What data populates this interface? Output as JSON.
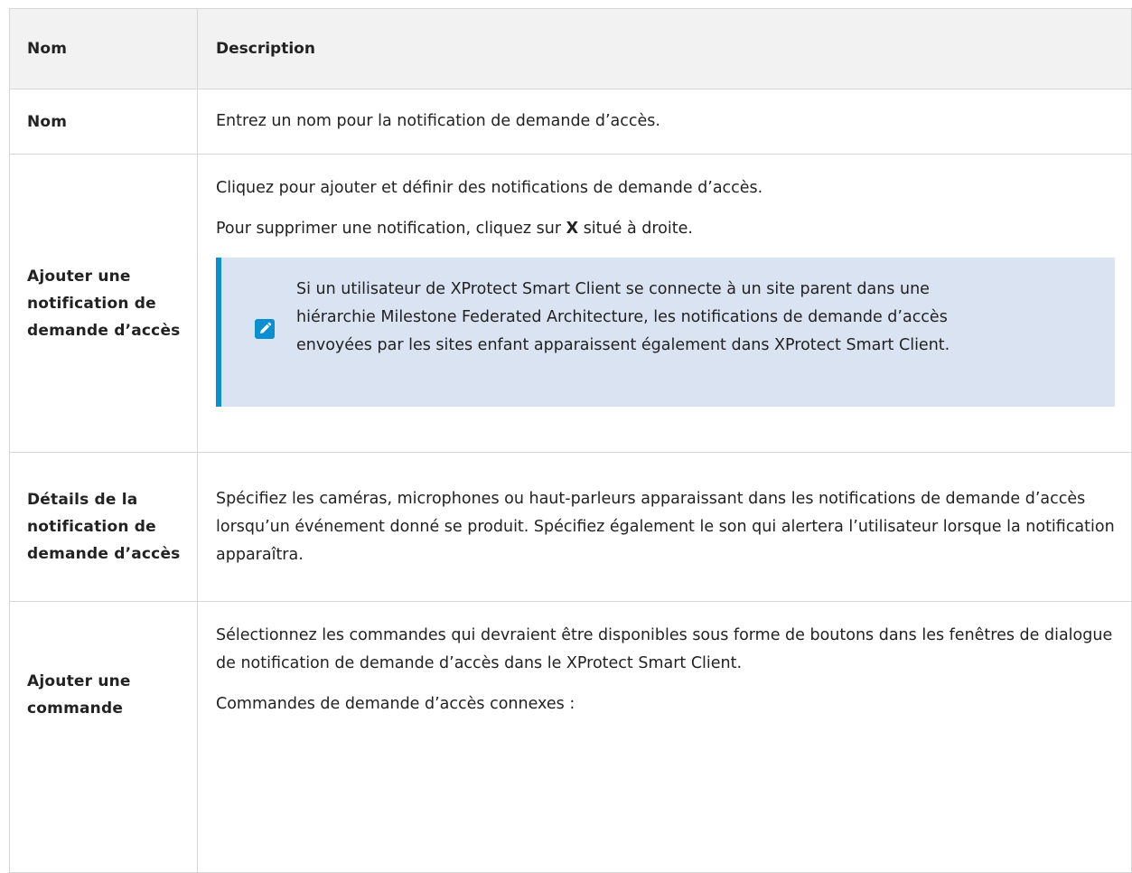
{
  "header": {
    "name_col": "Nom",
    "desc_col": "Description"
  },
  "rows": {
    "nom": {
      "name": "Nom",
      "desc": "Entrez un nom pour la notification de demande d’accès."
    },
    "ajout": {
      "name": "Ajouter une notification de demande d’accès",
      "desc1": "Cliquez pour ajouter et définir des notifications de demande d’accès.",
      "desc2_before": "Pour supprimer une notification, cliquez sur ",
      "desc2_bold": "X",
      "desc2_after": " situé à droite.",
      "note": "Si un utilisateur de XProtect Smart Client se connecte à un site parent dans une hiérarchie Milestone Federated Architecture, les notifications de demande d’accès envoyées par les sites enfant apparaissent également dans XProtect Smart Client.",
      "note_icon": "pencil-icon"
    },
    "details": {
      "name": "Détails de la notification de demande d’accès",
      "desc": "Spécifiez les caméras, microphones ou haut-parleurs apparaissant dans les notifications de demande d’accès lorsqu’un événement donné se produit. Spécifiez également le son qui alertera l’utilisateur lorsque la notification apparaîtra."
    },
    "commande": {
      "name": "Ajouter une commande",
      "desc1": "Sélectionnez les commandes qui devraient être disponibles sous forme de boutons dans les fenêtres de dialogue de notification de demande d’accès dans le XProtect Smart Client.",
      "desc2": "Commandes de demande d’accès connexes :"
    }
  },
  "colors": {
    "header_bg": "#f2f2f2",
    "note_bg": "#d9e3f1",
    "note_accent": "#0a8fd0",
    "border": "#d6d6d6"
  }
}
